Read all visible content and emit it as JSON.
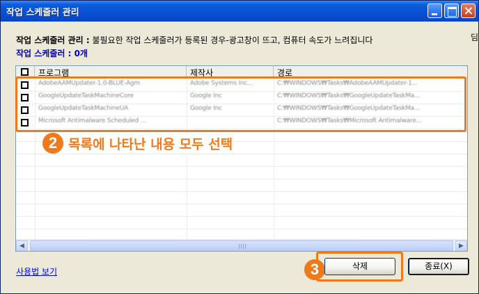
{
  "window": {
    "title": "작업 스케줄러 관리",
    "buttons": {
      "minimize": "minimize-icon",
      "maximize": "maximize-icon",
      "close": "close-icon"
    }
  },
  "info": {
    "label": "작업 스케줄러 관리 :",
    "description": "불필요한 작업 스케줄러가 등록된 경우-광고창이 뜨고, 컴퓨터 속도가 느려집니다",
    "count": "작업 스케줄러 : 0개",
    "edge_glyph": "딤"
  },
  "table": {
    "headers": [
      "프로그램",
      "제작사",
      "경로"
    ],
    "rows": [
      {
        "program": "AdobeAAMUpdater-1.0-BLUE-Agm",
        "vendor": "Adobe Systems Inc...",
        "path": "C:₩WINDOWS₩Tasks₩AdobeAAMUpdater-1..."
      },
      {
        "program": "GoogleUpdateTaskMachineCore",
        "vendor": "Google Inc",
        "path": "C:₩WINDOWS₩Tasks₩GoogleUpdateTaskMa..."
      },
      {
        "program": "GoogleUpdateTaskMachineUA",
        "vendor": "Google Inc",
        "path": "C:₩WINDOWS₩Tasks₩GoogleUpdateTaskMa..."
      },
      {
        "program": "Microsoft Antimalware Scheduled ...",
        "vendor": "",
        "path": "C:₩WINDOWS₩Tasks₩Microsoft Antimalware..."
      }
    ]
  },
  "annotations": {
    "step2_number": "2",
    "step2_text": "목록에 나타난 내용 모두 선택",
    "step3_number": "3",
    "color": "#f07a1a"
  },
  "footer": {
    "usage_link": "사용법 보기",
    "delete_button": "삭제",
    "exit_button": "종료(X)"
  }
}
